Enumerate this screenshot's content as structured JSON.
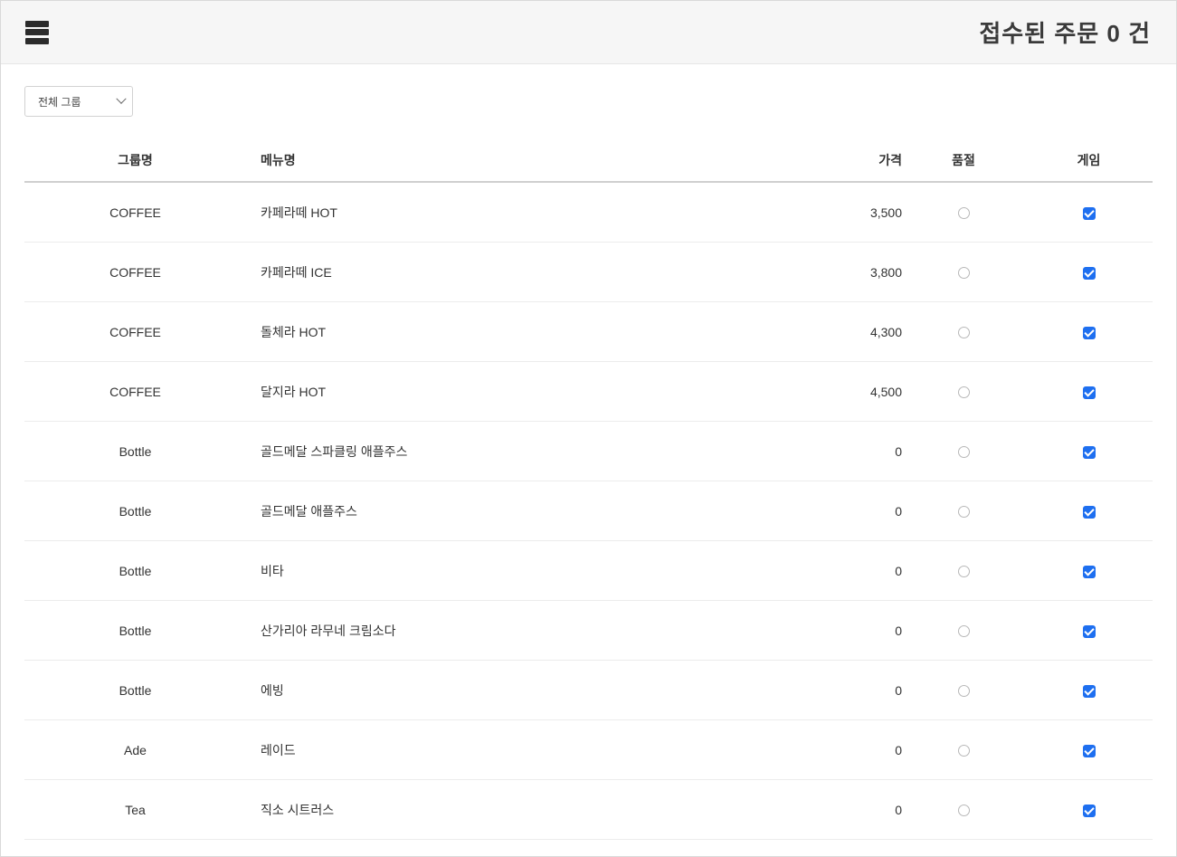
{
  "header": {
    "orders_status": "접수된 주문 0 건"
  },
  "filter": {
    "group_select_value": "전체 그룹"
  },
  "table": {
    "headers": {
      "group": "그룹명",
      "name": "메뉴명",
      "price": "가격",
      "soldout": "품절",
      "display": "게임"
    },
    "rows": [
      {
        "group": "COFFEE",
        "name": "카페라떼 HOT",
        "price": "3,500",
        "soldout": false,
        "display": true
      },
      {
        "group": "COFFEE",
        "name": "카페라떼 ICE",
        "price": "3,800",
        "soldout": false,
        "display": true
      },
      {
        "group": "COFFEE",
        "name": "돌체라 HOT",
        "price": "4,300",
        "soldout": false,
        "display": true
      },
      {
        "group": "COFFEE",
        "name": "달지라 HOT",
        "price": "4,500",
        "soldout": false,
        "display": true
      },
      {
        "group": "Bottle",
        "name": "골드메달 스파클링 애플주스",
        "price": "0",
        "soldout": false,
        "display": true
      },
      {
        "group": "Bottle",
        "name": "골드메달 애플주스",
        "price": "0",
        "soldout": false,
        "display": true
      },
      {
        "group": "Bottle",
        "name": "비타",
        "price": "0",
        "soldout": false,
        "display": true
      },
      {
        "group": "Bottle",
        "name": "산가리아 라무네 크림소다",
        "price": "0",
        "soldout": false,
        "display": true
      },
      {
        "group": "Bottle",
        "name": "에빙",
        "price": "0",
        "soldout": false,
        "display": true
      },
      {
        "group": "Ade",
        "name": "레이드",
        "price": "0",
        "soldout": false,
        "display": true
      },
      {
        "group": "Tea",
        "name": "직소 시트러스",
        "price": "0",
        "soldout": false,
        "display": true
      }
    ]
  },
  "colors": {
    "accent": "#1e6ff0",
    "header_bg": "#f6f6f6"
  },
  "icons": {
    "menu": "hamburger-icon",
    "select": "chevron-down-icon"
  }
}
